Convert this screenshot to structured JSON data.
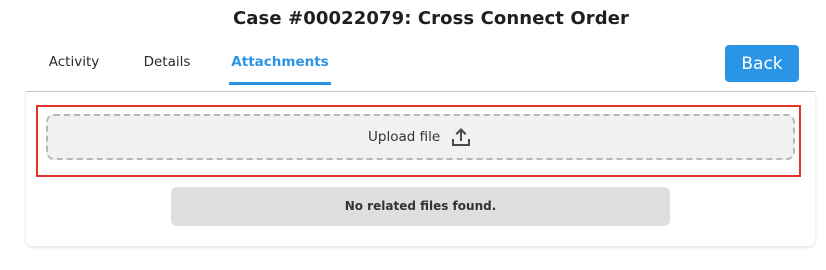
{
  "header": {
    "title": "Case #00022079: Cross Connect Order"
  },
  "tabs": [
    {
      "label": "Activity",
      "active": false
    },
    {
      "label": "Details",
      "active": false
    },
    {
      "label": "Attachments",
      "active": true
    }
  ],
  "actions": {
    "back_label": "Back"
  },
  "attachments": {
    "upload_label": "Upload file",
    "upload_icon": "upload-icon",
    "empty_message": "No related files found."
  },
  "colors": {
    "accent": "#2a95e6",
    "highlight": "#e1332c",
    "message_bg": "#dedede"
  }
}
